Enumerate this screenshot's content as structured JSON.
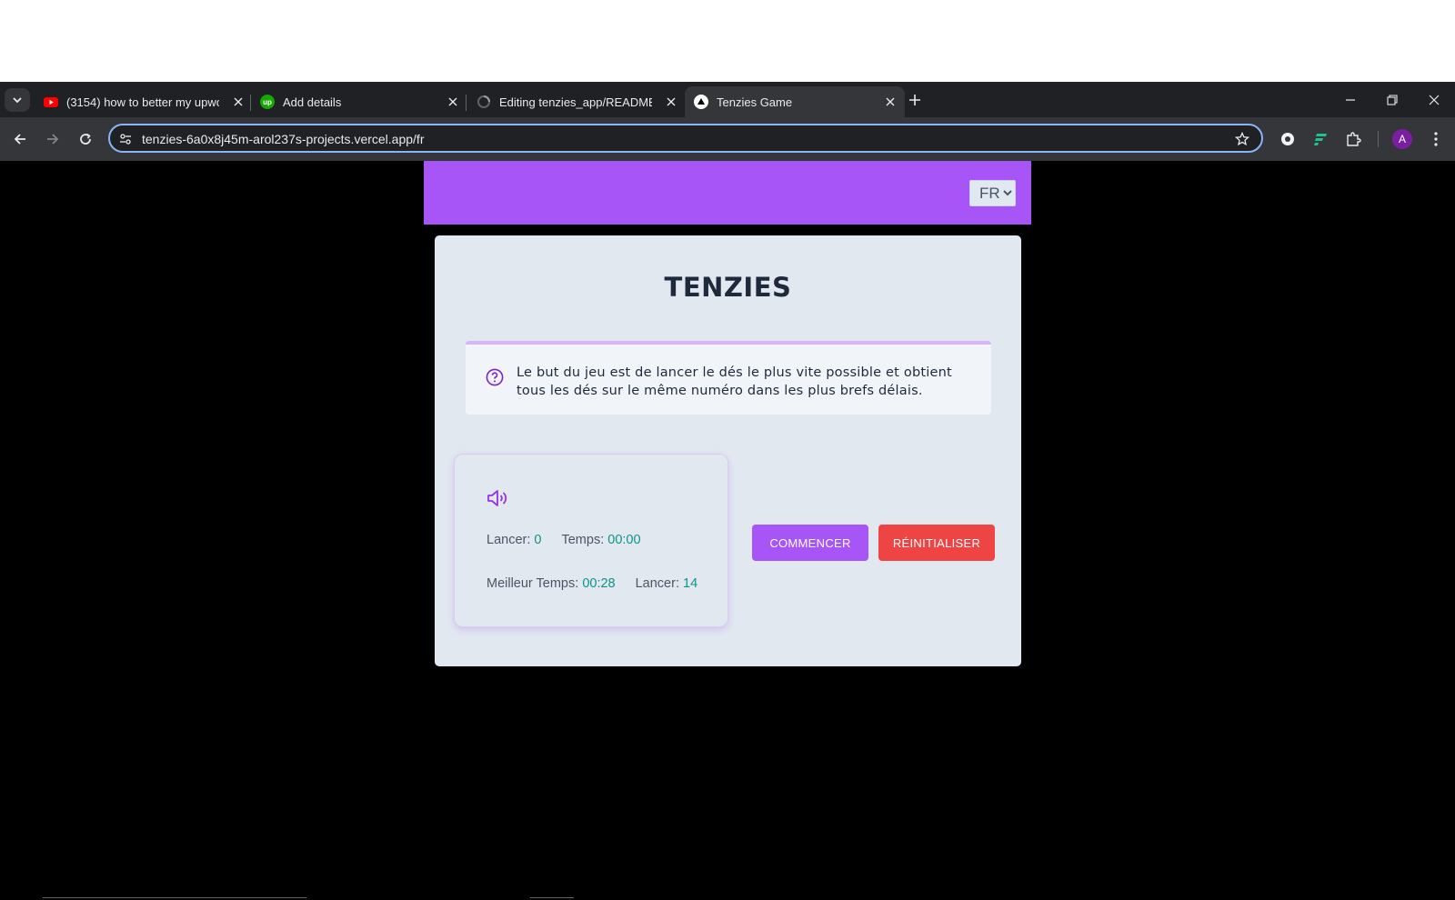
{
  "browser": {
    "tabs": [
      {
        "title": "(3154) how to better my upwo",
        "favicon": "youtube-icon",
        "active": false
      },
      {
        "title": "Add details",
        "favicon": "upwork-icon",
        "active": false
      },
      {
        "title": "Editing tenzies_app/README.m",
        "favicon": "github-loading-icon",
        "active": false
      },
      {
        "title": "Tenzies Game",
        "favicon": "vercel-icon",
        "active": true
      }
    ],
    "url": "tenzies-6a0x8j45m-arol237s-projects.vercel.app/fr",
    "profile_initial": "A",
    "colors": {
      "tabstrip": "#202124",
      "toolbar": "#35363a",
      "omnibox_focus": "#8ab4f8",
      "profile": "#7b1fa2"
    }
  },
  "app": {
    "language": {
      "selected": "FR"
    },
    "title": "TENZIES",
    "instructions": "Le but du jeu est de lancer le dés le plus vite possible et obtient tous les dés sur le même numéro dans les plus brefs délais.",
    "stats": {
      "rolls_label": "Lancer:",
      "rolls_value": "0",
      "time_label": "Temps:",
      "time_value": "00:00",
      "best_time_label": "Meilleur Temps:",
      "best_time_value": "00:28",
      "best_rolls_label": "Lancer:",
      "best_rolls_value": "14"
    },
    "buttons": {
      "start": "COMMENCER",
      "reset": "RÉINITIALISER"
    },
    "colors": {
      "header": "#a855f7",
      "card": "#e2e8f0",
      "start": "#a855f7",
      "reset": "#ef4444",
      "value": "#0d9488"
    }
  }
}
